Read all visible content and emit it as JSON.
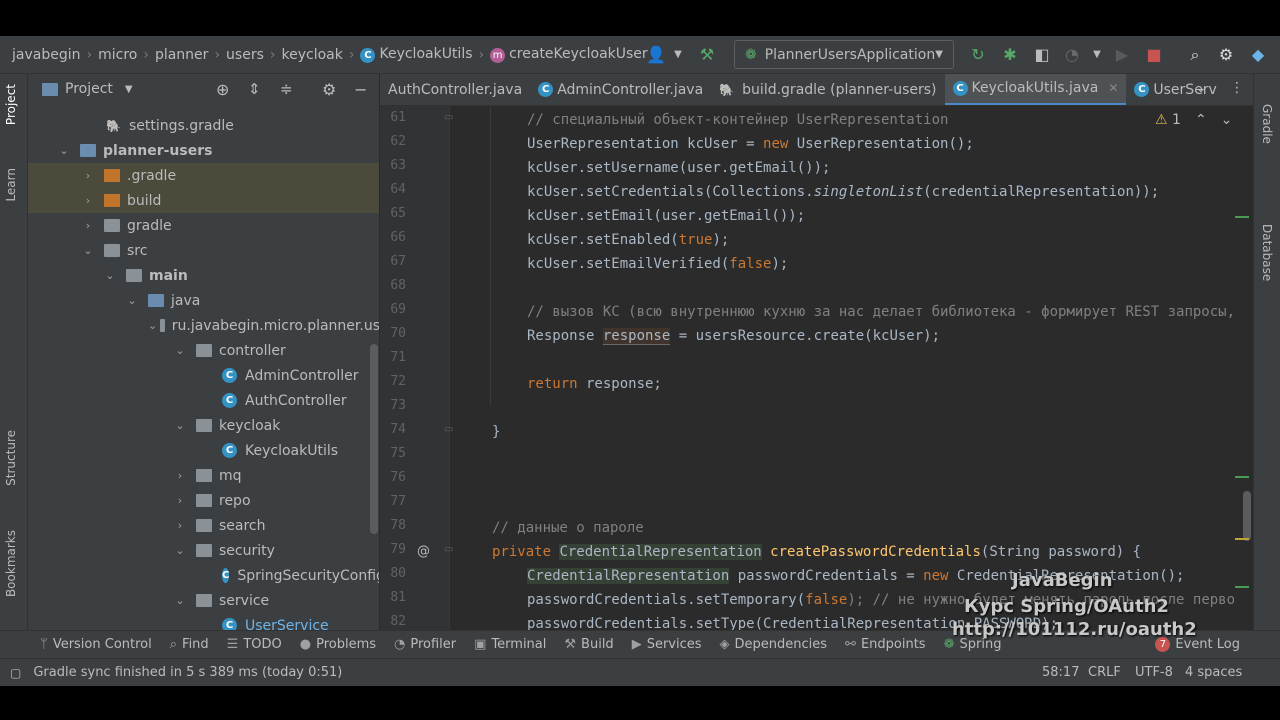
{
  "breadcrumb": [
    "javabegin",
    "micro",
    "planner",
    "users",
    "keycloak",
    "KeycloakUtils",
    "createKeycloakUser"
  ],
  "run_config": "PlannerUsersApplication",
  "left_strip": [
    "Project",
    "Learn",
    "Structure",
    "Bookmarks"
  ],
  "right_strip": [
    "Gradle",
    "Database"
  ],
  "project_panel": {
    "title": "Project",
    "tree": [
      {
        "label": "settings.gradle",
        "kind": "gradle"
      },
      {
        "label": "planner-users",
        "kind": "module",
        "bold": true
      },
      {
        "label": ".gradle",
        "kind": "folder-orange"
      },
      {
        "label": "build",
        "kind": "folder-orange"
      },
      {
        "label": "gradle",
        "kind": "folder"
      },
      {
        "label": "src",
        "kind": "folder"
      },
      {
        "label": "main",
        "kind": "folder-blue",
        "bold": true
      },
      {
        "label": "java",
        "kind": "folder-blue"
      },
      {
        "label": "ru.javabegin.micro.planner.us",
        "kind": "pkg"
      },
      {
        "label": "controller",
        "kind": "pkg"
      },
      {
        "label": "AdminController",
        "kind": "class"
      },
      {
        "label": "AuthController",
        "kind": "class"
      },
      {
        "label": "keycloak",
        "kind": "pkg"
      },
      {
        "label": "KeycloakUtils",
        "kind": "class"
      },
      {
        "label": "mq",
        "kind": "pkg"
      },
      {
        "label": "repo",
        "kind": "pkg"
      },
      {
        "label": "search",
        "kind": "pkg"
      },
      {
        "label": "security",
        "kind": "pkg"
      },
      {
        "label": "SpringSecurityConfig",
        "kind": "class"
      },
      {
        "label": "service",
        "kind": "pkg"
      },
      {
        "label": "UserService",
        "kind": "class"
      }
    ]
  },
  "tabs": [
    "AuthController.java",
    "AdminController.java",
    "build.gradle (planner-users)",
    "KeycloakUtils.java",
    "UserServ"
  ],
  "active_tab": "KeycloakUtils.java",
  "warning_count": "1",
  "line_numbers": [
    "61",
    "62",
    "63",
    "64",
    "65",
    "66",
    "67",
    "68",
    "69",
    "70",
    "71",
    "72",
    "73",
    "74",
    "75",
    "76",
    "77",
    "78",
    "79",
    "80",
    "81",
    "82"
  ],
  "code": {
    "l61": "// специальный объект-контейнер UserRepresentation",
    "l62a": "UserRepresentation kcUser = ",
    "l62b": "new",
    "l62c": " UserRepresentation();",
    "l63": "kcUser.setUsername(user.getEmail());",
    "l64a": "kcUser.setCredentials(Collections.",
    "l64b": "singletonList",
    "l64c": "(credentialRepresentation));",
    "l65": "kcUser.setEmail(user.getEmail());",
    "l66a": "kcUser.setEnabled(",
    "l66b": "true",
    "l66c": ");",
    "l67a": "kcUser.setEmailVerified(",
    "l67b": "false",
    "l67c": ");",
    "l69": "// вызов KC (всю внутреннюю кухню за нас делает библиотека - формирует REST запросы,",
    "l70a": "Response ",
    "l70b": "response",
    "l70c": " = usersResource.create(kcUser);",
    "l72a": "return",
    "l72b": " response;",
    "l74": "}",
    "l78": "// данные о пароле",
    "l79a": "private ",
    "l79b": "CredentialRepresentation",
    "l79c": " ",
    "l79d": "createPasswordCredentials",
    "l79e": "(String password) {",
    "l80a": "CredentialRepresentation",
    "l80b": " passwordCredentials = ",
    "l80c": "new",
    "l80d": " CredentialRepresentation();",
    "l81a": "passwordCredentials.setTemporary(",
    "l81b": "false",
    "l81c": "); // не нужно будет менять пароль после перво",
    "l82": "passwordCredentials.setType(CredentialRepresentation.PASSWORD);"
  },
  "bottom_tools": [
    "Version Control",
    "Find",
    "TODO",
    "Problems",
    "Profiler",
    "Terminal",
    "Build",
    "Services",
    "Dependencies",
    "Endpoints",
    "Spring",
    "Event Log"
  ],
  "event_log_count": "7",
  "status": {
    "message": "Gradle sync finished in 5 s 389 ms (today 0:51)",
    "position": "58:17",
    "line_sep": "CRLF",
    "encoding": "UTF-8",
    "indent": "4 spaces"
  },
  "watermark": [
    "JavaBegin",
    "Курс Spring/OAuth2",
    "http://101112.ru/oauth2"
  ]
}
